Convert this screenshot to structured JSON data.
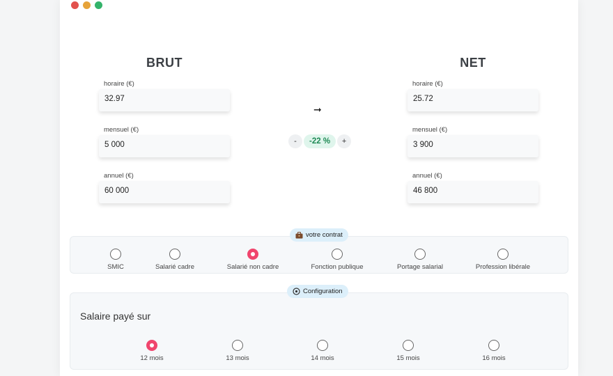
{
  "window": {
    "dot_colors": [
      "#e2514d",
      "#e6a33a",
      "#34b36a"
    ]
  },
  "brut": {
    "title": "BRUT",
    "fields": [
      {
        "label": "horaire (€)",
        "value": "32.97"
      },
      {
        "label": "mensuel (€)",
        "value": "5 000"
      },
      {
        "label": "annuel (€)",
        "value": "60 000"
      }
    ]
  },
  "net": {
    "title": "NET",
    "fields": [
      {
        "label": "horaire (€)",
        "value": "25.72"
      },
      {
        "label": "mensuel (€)",
        "value": "3 900"
      },
      {
        "label": "annuel (€)",
        "value": "46 800"
      }
    ]
  },
  "conversion": {
    "arrow": "➞",
    "minus": "-",
    "plus": "+",
    "rate": "-22 %"
  },
  "contract": {
    "pill_label": "votre contrat",
    "icon": "briefcase-icon",
    "selected": 2,
    "options": [
      "SMIC",
      "Salarié cadre",
      "Salarié non cadre",
      "Fonction publique",
      "Portage salarial",
      "Profession libérale"
    ]
  },
  "configuration": {
    "pill_label": "Configuration",
    "icon": "gear-icon",
    "heading": "Salaire payé sur",
    "selected": 0,
    "options": [
      "12 mois",
      "13 mois",
      "14 mois",
      "15 mois",
      "16 mois"
    ]
  },
  "colors": {
    "accent": "#f0456d",
    "rate_text": "#1f8a55",
    "pill_bg": "#dceffa"
  }
}
